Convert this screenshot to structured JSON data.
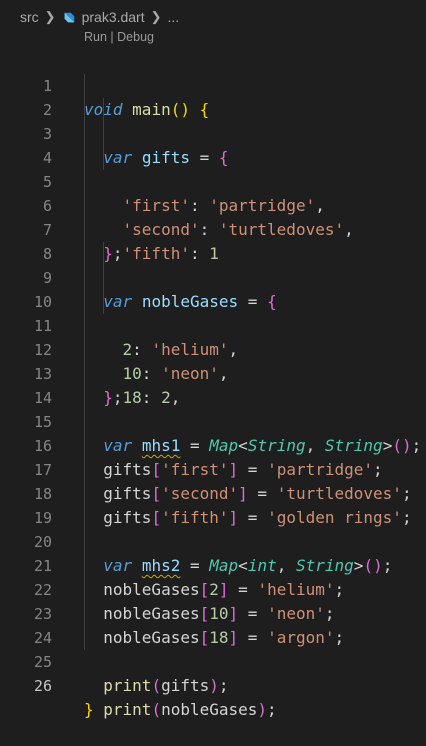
{
  "breadcrumb": {
    "folder": "src",
    "file": "prak3.dart",
    "more": "...",
    "file_icon": "dart-icon"
  },
  "codelens": {
    "run": "Run",
    "separator": "|",
    "debug": "Debug"
  },
  "line_numbers": [
    "1",
    "2",
    "3",
    "4",
    "5",
    "6",
    "7",
    "8",
    "9",
    "10",
    "11",
    "12",
    "13",
    "14",
    "15",
    "16",
    "17",
    "18",
    "19",
    "20",
    "21",
    "22",
    "23",
    "24",
    "25",
    "26"
  ],
  "code": {
    "l1": {
      "kw": "void",
      "fn": "main",
      "paren": "()",
      "brace": "{"
    },
    "l2": {
      "kw": "var",
      "name": "gifts",
      "eq": "=",
      "brace": "{"
    },
    "l3": {
      "key": "'first'",
      "colon": ":",
      "val": "'partridge'",
      "comma": ","
    },
    "l4": {
      "key": "'second'",
      "colon": ":",
      "val": "'turtledoves'",
      "comma": ","
    },
    "l5": {
      "key": "'fifth'",
      "colon": ":",
      "val": "1"
    },
    "l6": {
      "brace": "}",
      "semi": ";"
    },
    "l8": {
      "kw": "var",
      "name": "nobleGases",
      "eq": "=",
      "brace": "{"
    },
    "l9": {
      "key": "2",
      "colon": ":",
      "val": "'helium'",
      "comma": ","
    },
    "l10": {
      "key": "10",
      "colon": ":",
      "val": "'neon'",
      "comma": ","
    },
    "l11": {
      "key": "18",
      "colon": ":",
      "val": "2",
      "comma": ","
    },
    "l12": {
      "brace": "}",
      "semi": ";"
    },
    "l14": {
      "kw": "var",
      "name": "mhs1",
      "eq": "=",
      "type": "Map",
      "lt": "<",
      "t1": "String",
      "comma": ",",
      "t2": "String",
      "gt": ">",
      "paren": "()",
      "semi": ";"
    },
    "l15": {
      "obj": "gifts",
      "lb": "[",
      "key": "'first'",
      "rb": "]",
      "eq": "=",
      "val": "'partridge'",
      "semi": ";"
    },
    "l16": {
      "obj": "gifts",
      "lb": "[",
      "key": "'second'",
      "rb": "]",
      "eq": "=",
      "val": "'turtledoves'",
      "semi": ";"
    },
    "l17": {
      "obj": "gifts",
      "lb": "[",
      "key": "'fifth'",
      "rb": "]",
      "eq": "=",
      "val": "'golden rings'",
      "semi": ";"
    },
    "l19": {
      "kw": "var",
      "name": "mhs2",
      "eq": "=",
      "type": "Map",
      "lt": "<",
      "t1": "int",
      "comma": ",",
      "t2": "String",
      "gt": ">",
      "paren": "()",
      "semi": ";"
    },
    "l20": {
      "obj": "nobleGases",
      "lb": "[",
      "key": "2",
      "rb": "]",
      "eq": "=",
      "val": "'helium'",
      "semi": ";"
    },
    "l21": {
      "obj": "nobleGases",
      "lb": "[",
      "key": "10",
      "rb": "]",
      "eq": "=",
      "val": "'neon'",
      "semi": ";"
    },
    "l22": {
      "obj": "nobleGases",
      "lb": "[",
      "key": "18",
      "rb": "]",
      "eq": "=",
      "val": "'argon'",
      "semi": ";"
    },
    "l24": {
      "fn": "print",
      "lp": "(",
      "arg": "gifts",
      "rp": ")",
      "semi": ";"
    },
    "l25": {
      "fn": "print",
      "lp": "(",
      "arg": "nobleGases",
      "rp": ")",
      "semi": ";"
    },
    "l26": {
      "brace": "}"
    }
  },
  "colors": {
    "background": "#1e1e1e",
    "keyword": "#569cd6",
    "function": "#dcdcaa",
    "variable": "#9cdcfe",
    "string": "#ce9178",
    "number": "#b5cea8",
    "type": "#4ec9b0",
    "bracket_level1": "#ffd700",
    "bracket_level2": "#da70d6",
    "bracket_level3": "#179fff",
    "warning_squiggle": "#cca700"
  }
}
